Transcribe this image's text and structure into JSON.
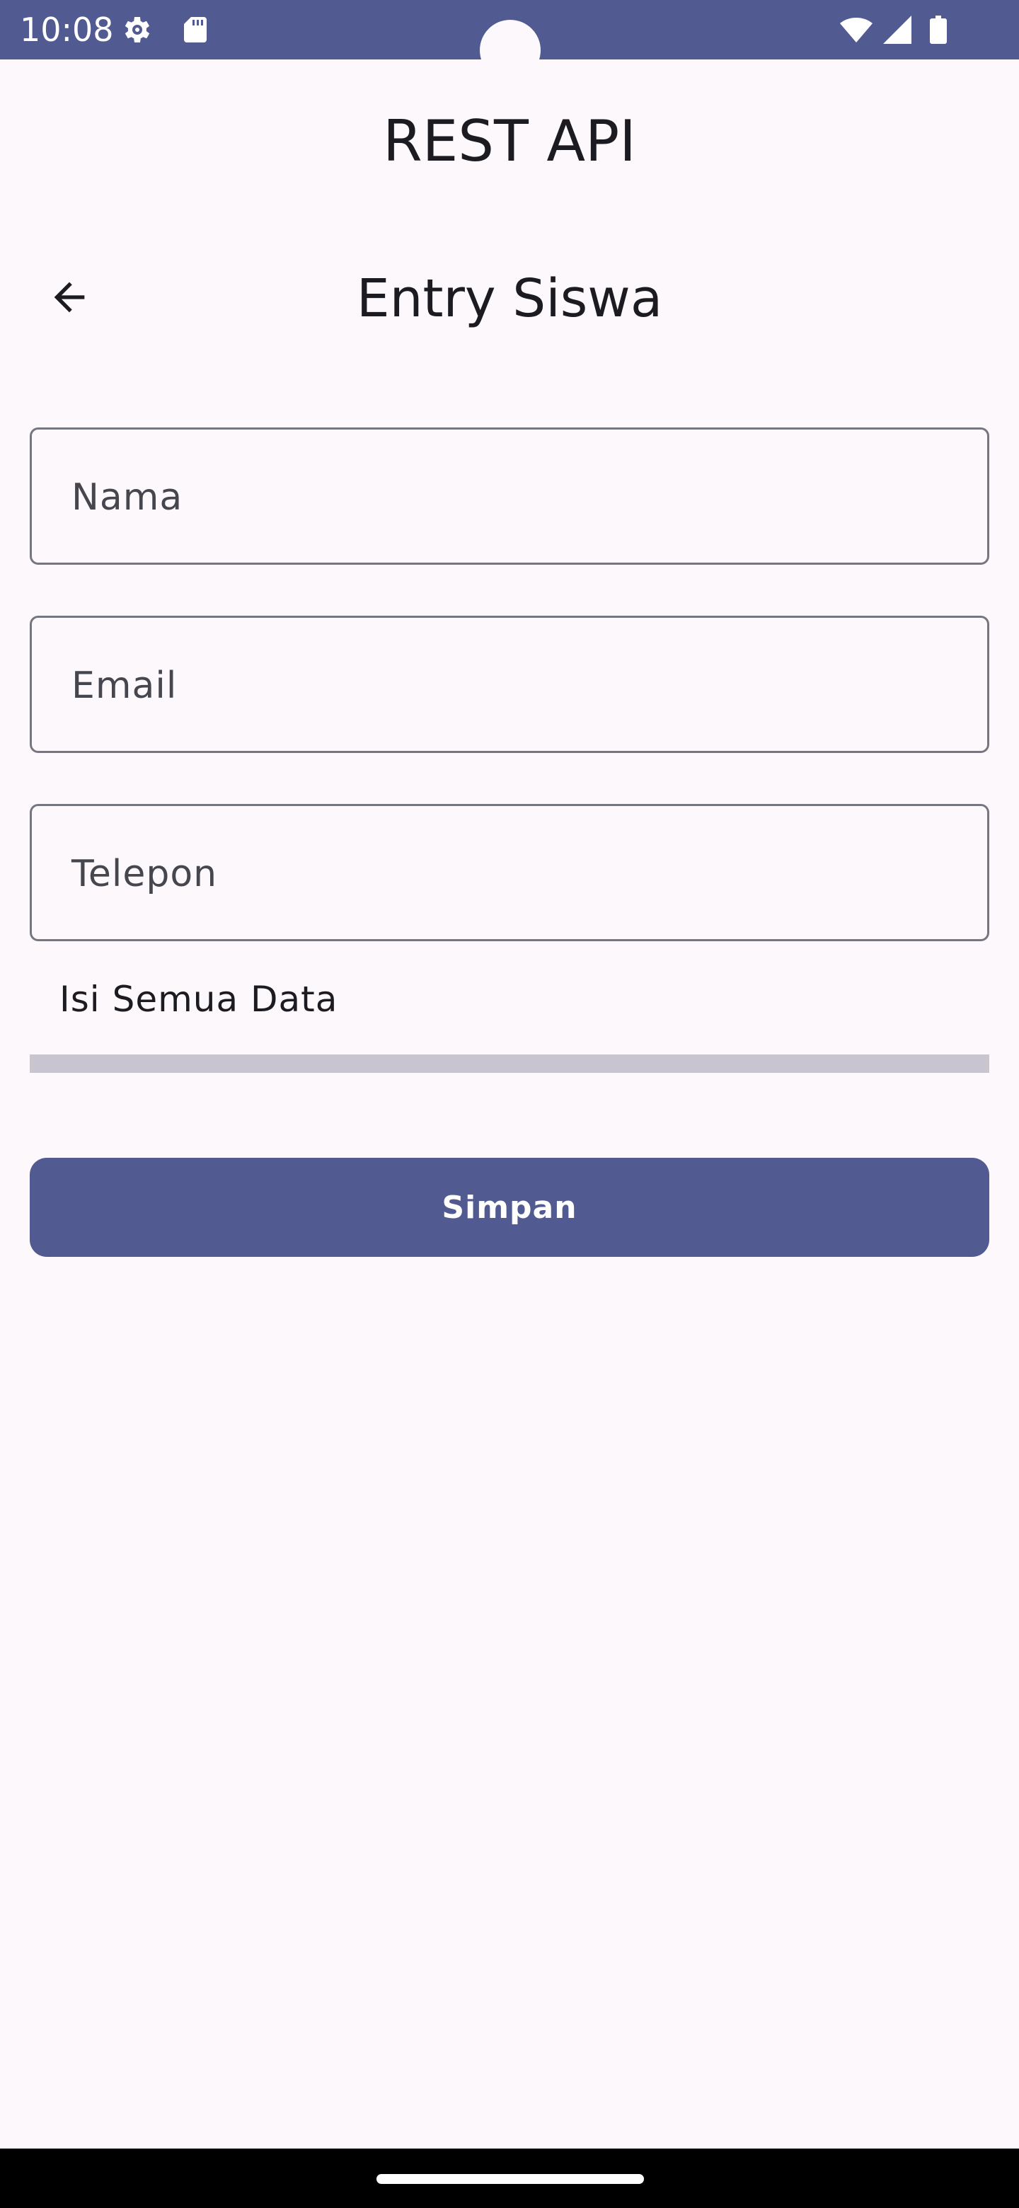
{
  "status_bar": {
    "time": "10:08",
    "icons": [
      "settings-gear-icon",
      "sd-card-icon",
      "wifi-icon",
      "signal-icon",
      "battery-icon"
    ],
    "background_color": "#515B92"
  },
  "app": {
    "title": "REST API"
  },
  "top_bar": {
    "back_icon": "arrow-back-icon",
    "title": "Entry Siswa"
  },
  "form": {
    "fields": [
      {
        "placeholder": "Nama",
        "value": ""
      },
      {
        "placeholder": "Email",
        "value": ""
      },
      {
        "placeholder": "Telepon",
        "value": ""
      }
    ],
    "helper_text": "Isi Semua Data",
    "submit_label": "Simpan"
  },
  "colors": {
    "primary": "#515B92",
    "background": "#FCF8FC",
    "outline": "#767680",
    "divider": "#C9C5D0",
    "on_surface": "#1B1B21"
  }
}
